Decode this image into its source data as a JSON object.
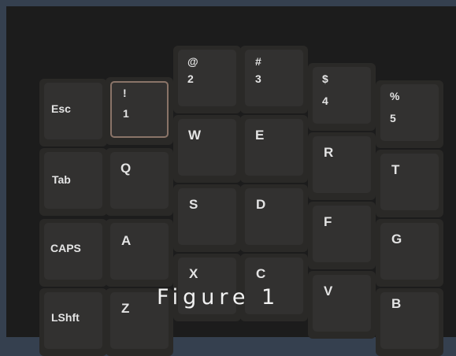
{
  "keys": {
    "esc": "Esc",
    "tab": "Tab",
    "caps": "CAPS",
    "lshift": "LShft",
    "one_shift": "!",
    "one_main": "1",
    "two_shift": "@",
    "two_main": "2",
    "three_shift": "#",
    "three_main": "3",
    "four_shift": "$",
    "four_main": "4",
    "five_shift": "%",
    "five_main": "5",
    "q": "Q",
    "w": "W",
    "e": "E",
    "r": "R",
    "t": "T",
    "a": "A",
    "s": "S",
    "d": "D",
    "f": "F",
    "g": "G",
    "z": "Z",
    "x": "X",
    "c": "C",
    "v": "V",
    "b": "B"
  },
  "caption": "Figure 1",
  "colors": {
    "background": "#35404f",
    "keyboard_case": "#1c1c1c",
    "plate": "#252423",
    "key": "#323130",
    "legend": "#e4e4e4",
    "selected_outline": "#8a7468"
  }
}
